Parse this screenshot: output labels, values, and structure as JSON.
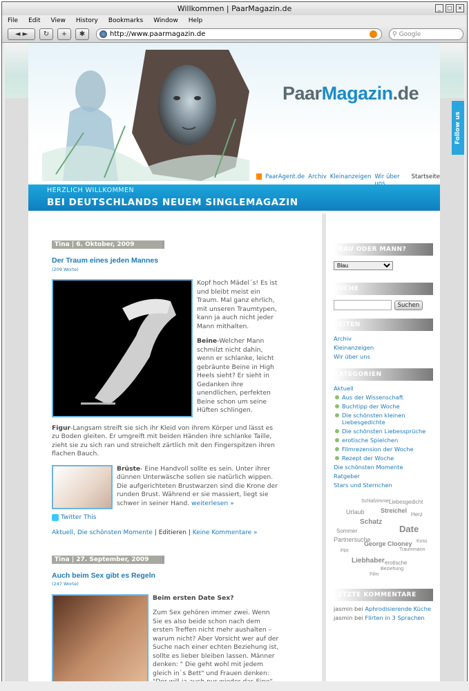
{
  "browser": {
    "title": "Willkommen | PaarMagazin.de",
    "menu": [
      "File",
      "Edit",
      "View",
      "History",
      "Bookmarks",
      "Window",
      "Help"
    ],
    "url": "http://www.paarmagazin.de",
    "search_placeholder": "Google",
    "window_buttons": [
      "_",
      "□",
      "×"
    ],
    "toolbar_icons": [
      "◄ ►",
      "↻",
      "+",
      "✱"
    ]
  },
  "site": {
    "logo_pre": "Paar",
    "logo_brand": "Magazin",
    "logo_post": ".de",
    "nav": [
      "PaarAgent.de",
      "Archiv",
      "Kleinanzeigen",
      "Wir über uns",
      "Startseite"
    ],
    "banner_small": "HERZLICH WILLKOMMEN",
    "banner_big": "BEI DEUTSCHLANDS NEUEM SINGLEMAGAZIN",
    "follow": "Follow us"
  },
  "posts": [
    {
      "date": "Tina | 6. Oktober, 2009",
      "title": "Der Traum eines jeden Mannes",
      "words": "(209 Worte)",
      "p1": "Kopf hoch Mädel´s! Es ist und bleibt meist ein Traum. Mal ganz ehrlich, mit unseren Traumtypen, kann ja auch nicht jeder Mann mithalten.",
      "p2_head": "Beine",
      "p2": "-Welcher Mann schmilzt nicht dahin, wenn er schlanke, leicht gebräunte Beine in High Heels sieht? Er sieht in Gedanken ihre unendlichen, perfekten Beine schon um seine Hüften schlingen.",
      "p3_head": "Figur",
      "p3": "-Langsam streift sie sich ihr Kleid von ihrem Körper und lässt es zu Boden gleiten. Er umgreift mit beiden Händen ihre schlanke Taille, zieht sie zu sich ran und streichelt zärtlich mit den Fingerspitzen ihren flachen Bauch.",
      "p4_head": "Brüste",
      "p4": "- Eine Handvoll sollte es sein. Unter ihrer dünnen Unterwäsche sollen sie natürlich wippen. Die aufgerichteten Brustwarzen sind die Krone der runden Brust. Während er sie massiert, liegt sie schwer in seiner Hand.",
      "more": "weiterlesen »",
      "twitter": "Twitter This",
      "cats": "Aktuell, Die schönsten Momente",
      "edit": "Editieren",
      "comments": "Keine Kommentare »"
    },
    {
      "date": "Tina | 27. September, 2009",
      "title": "Auch beim Sex gibt es Regeln",
      "words": "(247 Worte)",
      "head": "Beim ersten Date Sex?",
      "p1": "Zum Sex gehören immer zwei. Wenn Sie es also beide schon nach dem ersten Treffen nicht mehr aushalten – warum nicht? Aber Vorsicht wer auf der Suche nach einer echten Beziehung ist, sollte es lieber bleiben lassen. Männer denken: \" Die geht wohl mit jedem gleich in`s Bett\" und Frauen denken: \"Der will ja auch nur wieder das Eine\""
    }
  ],
  "sidebar": {
    "w1_title": "FRAU ODER MANN?",
    "w1_select": "Blau",
    "w2_title": "SUCHE",
    "w2_button": "Suchen",
    "w3_title": "SEITEN",
    "w3_links": [
      "Archiv",
      "Kleinanzeigen",
      "Wir über uns"
    ],
    "w4_title": "KATEGORIEN",
    "w4_top": "Aktuell",
    "w4_sub": [
      "Aus der Wissenschaft",
      "Buchtipp der Woche",
      "Die schönsten kleinen Liebesgedichte",
      "Die schönsten Liebessprüche",
      "erotische Spielchen",
      "Filmrezension der Woche",
      "Rezept der Woche"
    ],
    "w4_more": [
      "Die schönsten Momente",
      "Ratgeber",
      "Stars und Sternchen"
    ],
    "cloud": [
      "Schlafzimmer",
      "Liebesgedicht",
      "Urlaub",
      "Streichel",
      "Herz",
      "Schatz",
      "Date",
      "Sommer",
      "Partnersuche",
      "George Clooney",
      "Traummann",
      "Liebhaber",
      "erotische",
      "Beziehung",
      "Film",
      "Flirt",
      "Kuss"
    ],
    "w5_title": "LETZTE KOMMENTARE",
    "w5_items": [
      {
        "who": "jasmin bei",
        "what": "Aphrodisierende Küche"
      },
      {
        "who": "jasmin bei",
        "what": "Flirten in 3 Sprachen"
      }
    ]
  }
}
